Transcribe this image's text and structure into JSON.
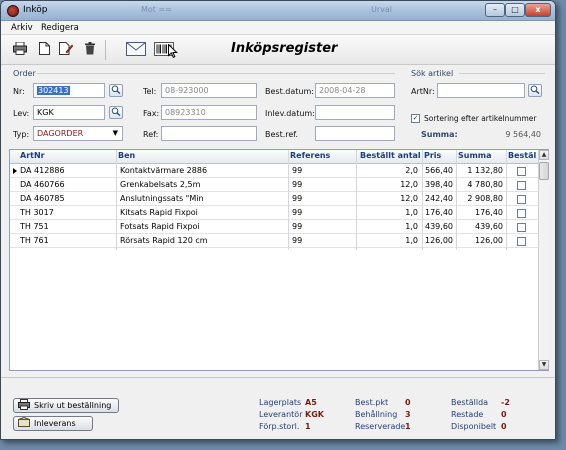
{
  "window": {
    "title": "Inköp",
    "ghost_tabs": [
      "Mot ==",
      "Urval"
    ],
    "controls": {
      "minimize": "–",
      "maximize": "□",
      "close": "x"
    }
  },
  "menu": {
    "items": [
      "Arkiv",
      "Redigera"
    ]
  },
  "toolbar": {
    "title": "Inköpsregister",
    "icons": [
      "printer-icon",
      "new-document-icon",
      "edit-document-icon",
      "trash-icon",
      "envelope-icon",
      "barcode-icon"
    ]
  },
  "order": {
    "group_label": "Order",
    "nr": {
      "label": "Nr:",
      "value": "302413"
    },
    "lev": {
      "label": "Lev:",
      "value": "KGK"
    },
    "typ": {
      "label": "Typ:",
      "value": "DAGORDER"
    },
    "tel": {
      "label": "Tel:",
      "value": "08-923000"
    },
    "fax": {
      "label": "Fax:",
      "value": "08923310"
    },
    "ref": {
      "label": "Ref:",
      "value": ""
    },
    "best_datum": {
      "label": "Best.datum:",
      "value": "2008-04-28"
    },
    "inlev_datum": {
      "label": "Inlev.datum:",
      "value": ""
    },
    "best_ref": {
      "label": "Best.ref.",
      "value": ""
    }
  },
  "search": {
    "group_label": "Sök artikel",
    "artnr": {
      "label": "ArtNr:",
      "value": ""
    },
    "sort_checkbox": {
      "label": "Sortering efter artikelnummer",
      "checked": true
    },
    "summa": {
      "label": "Summa:",
      "value": "9 564,40"
    }
  },
  "table": {
    "columns": [
      "ArtNr",
      "Ben",
      "Referens",
      "Beställt antal",
      "Pris",
      "Summa",
      "Beställ"
    ],
    "rows": [
      {
        "artnr": "DA 412886",
        "ben": "Kontaktvärmare 2886",
        "referens": "99",
        "antal": "2,0",
        "pris": "566,40",
        "summa": "1 132,80",
        "bestall": false,
        "current": true
      },
      {
        "artnr": "DA 460766",
        "ben": "Grenkabelsats 2,5m",
        "referens": "99",
        "antal": "12,0",
        "pris": "398,40",
        "summa": "4 780,80",
        "bestall": false,
        "current": false
      },
      {
        "artnr": "DA 460785",
        "ben": "Anslutningssats \"Min",
        "referens": "99",
        "antal": "12,0",
        "pris": "242,40",
        "summa": "2 908,80",
        "bestall": false,
        "current": false
      },
      {
        "artnr": "TH 3017",
        "ben": "Kitsats Rapid Fixpoi",
        "referens": "99",
        "antal": "1,0",
        "pris": "176,40",
        "summa": "176,40",
        "bestall": false,
        "current": false
      },
      {
        "artnr": "TH 751",
        "ben": "Fotsats Rapid Fixpoi",
        "referens": "99",
        "antal": "1,0",
        "pris": "439,60",
        "summa": "439,60",
        "bestall": false,
        "current": false
      },
      {
        "artnr": "TH 761",
        "ben": "Rörsats Rapid 120 cm",
        "referens": "99",
        "antal": "1,0",
        "pris": "126,00",
        "summa": "126,00",
        "bestall": false,
        "current": false
      }
    ]
  },
  "buttons": {
    "print_order": "Skriv ut beställning",
    "delivery": "Inleverans"
  },
  "status": {
    "lagerplats": {
      "label": "Lagerplats",
      "value": "A5"
    },
    "leverantor": {
      "label": "Leverantör",
      "value": "KGK"
    },
    "forp_storl": {
      "label": "Förp.storl.",
      "value": "1"
    },
    "best_pkt": {
      "label": "Best.pkt",
      "value": "0"
    },
    "behallning": {
      "label": "Behållning",
      "value": "3"
    },
    "reserverade": {
      "label": "Reserverade",
      "value": "1"
    },
    "bestallda": {
      "label": "Beställda",
      "value": "-2"
    },
    "restade": {
      "label": "Restade",
      "value": "0"
    },
    "disponibelt": {
      "label": "Disponibelt",
      "value": "0"
    }
  }
}
